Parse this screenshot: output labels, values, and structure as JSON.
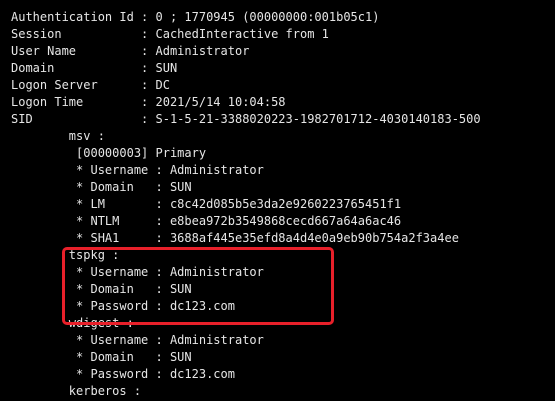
{
  "colors": {
    "background": "#000000",
    "text": "#e6e6e6",
    "highlight": "#e8202a"
  },
  "lines": [
    "Authentication Id : 0 ; 1770945 (00000000:001b05c1)",
    "Session           : CachedInteractive from 1",
    "User Name         : Administrator",
    "Domain            : SUN",
    "Logon Server      : DC",
    "Logon Time        : 2021/5/14 10:04:58",
    "SID               : S-1-5-21-3388020223-1982701712-4030140183-500",
    "        msv :",
    "         [00000003] Primary",
    "         * Username : Administrator",
    "         * Domain   : SUN",
    "         * LM       : c8c42d085b5e3da2e9260223765451f1",
    "         * NTLM     : e8bea972b3549868cecd667a64a6ac46",
    "         * SHA1     : 3688af445e35efd8a4d4e0a9eb90b754a2f3a4ee",
    "        tspkg :",
    "         * Username : Administrator",
    "         * Domain   : SUN",
    "         * Password : dc123.com",
    "        wdigest :",
    "         * Username : Administrator",
    "         * Domain   : SUN",
    "         * Password : dc123.com",
    "        kerberos :"
  ]
}
